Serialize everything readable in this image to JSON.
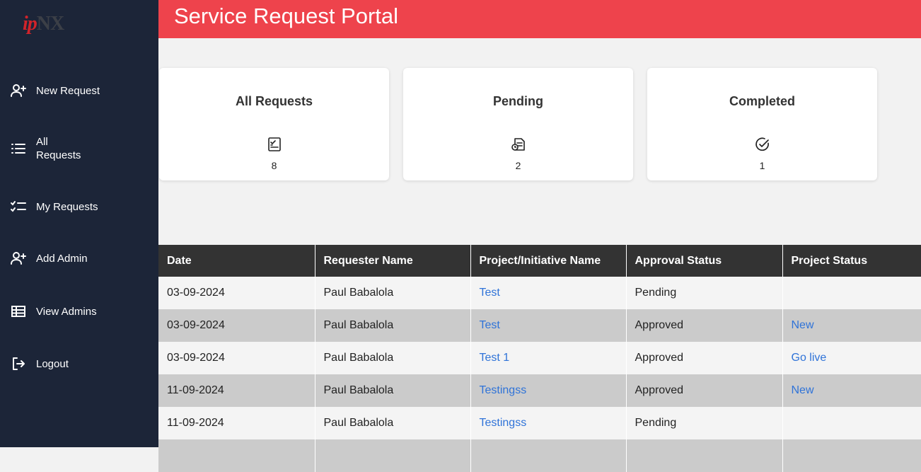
{
  "logo": {
    "ip": "ip",
    "nx": "NX"
  },
  "header": {
    "title": "Service Request Portal"
  },
  "sidebar": {
    "items": [
      {
        "label": "New Request",
        "icon": "user-plus-icon"
      },
      {
        "label": "All Requests",
        "icon": "list-icon"
      },
      {
        "label": "My Requests",
        "icon": "checklist-icon"
      },
      {
        "label": "Add Admin",
        "icon": "user-plus-icon"
      },
      {
        "label": "View Admins",
        "icon": "table-icon"
      },
      {
        "label": "Logout",
        "icon": "logout-icon"
      }
    ]
  },
  "cards": [
    {
      "title": "All Requests",
      "count": "8",
      "icon": "clipboard-check-icon"
    },
    {
      "title": "Pending",
      "count": "2",
      "icon": "document-clock-icon"
    },
    {
      "title": "Completed",
      "count": "1",
      "icon": "check-circle-icon"
    }
  ],
  "table": {
    "headers": [
      "Date",
      "Requester Name",
      "Project/Initiative Name",
      "Approval Status",
      "Project Status"
    ],
    "rows": [
      {
        "date": "03-09-2024",
        "requester": "Paul Babalola",
        "project": "Test",
        "approval": "Pending",
        "status": ""
      },
      {
        "date": "03-09-2024",
        "requester": "Paul Babalola",
        "project": "Test",
        "approval": "Approved",
        "status": "New"
      },
      {
        "date": "03-09-2024",
        "requester": "Paul Babalola",
        "project": "Test 1",
        "approval": "Approved",
        "status": "Go live"
      },
      {
        "date": "11-09-2024",
        "requester": "Paul Babalola",
        "project": "Testingss",
        "approval": "Approved",
        "status": "New"
      },
      {
        "date": "11-09-2024",
        "requester": "Paul Babalola",
        "project": "Testingss",
        "approval": "Pending",
        "status": ""
      },
      {
        "date": "",
        "requester": "",
        "project": "",
        "approval": "",
        "status": ""
      }
    ]
  },
  "colors": {
    "sidebar": "#1c2538",
    "header": "#ee434c",
    "link": "#2f73d8",
    "table_header": "#333333"
  }
}
